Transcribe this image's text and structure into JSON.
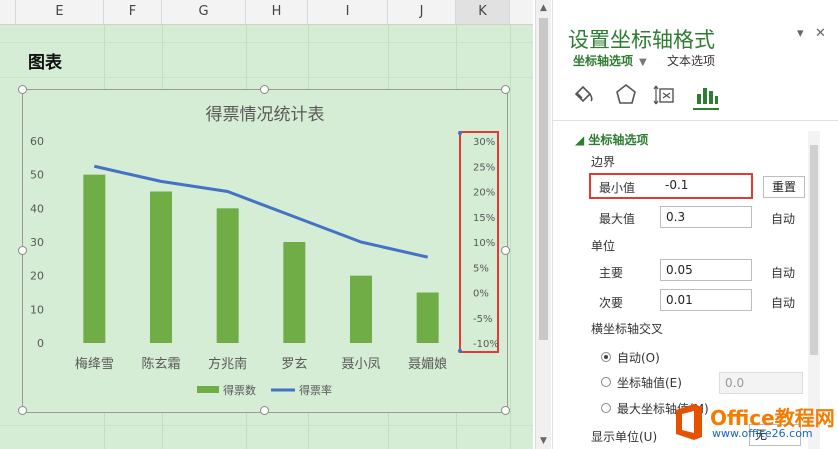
{
  "spreadsheet": {
    "columns": [
      "E",
      "F",
      "G",
      "H",
      "I",
      "J",
      "K"
    ],
    "selected_column": "K",
    "sheet_title": "图表"
  },
  "chart_data": {
    "type": "bar",
    "title": "得票情况统计表",
    "categories": [
      "梅绛雪",
      "陈玄霜",
      "方兆南",
      "罗玄",
      "聂小凤",
      "聂媚娘"
    ],
    "series": [
      {
        "name": "得票数",
        "type": "bar",
        "axis": "primary",
        "values": [
          50,
          45,
          40,
          30,
          20,
          15
        ],
        "color": "#70ad47"
      },
      {
        "name": "得票率",
        "type": "line",
        "axis": "secondary",
        "values": [
          0.25,
          0.22,
          0.2,
          0.15,
          0.1,
          0.07
        ],
        "color": "#4472c4"
      }
    ],
    "primary_axis": {
      "ylim": [
        0,
        60
      ],
      "ticks": [
        "0",
        "10",
        "20",
        "30",
        "40",
        "50",
        "60"
      ]
    },
    "secondary_axis": {
      "ylim": [
        -0.1,
        0.3
      ],
      "ticks": [
        "-10%",
        "-5%",
        "0%",
        "5%",
        "10%",
        "15%",
        "20%",
        "25%",
        "30%"
      ],
      "highlighted": true
    },
    "legend": "bottom",
    "grid": false
  },
  "pane": {
    "title": "设置坐标轴格式",
    "tab_axis_options": "坐标轴选项",
    "tab_text_options": "文本选项",
    "icons": [
      "fill-line-icon",
      "effects-icon",
      "size-properties-icon",
      "axis-options-icon"
    ],
    "section": "坐标轴选项",
    "bounds_label": "边界",
    "min_label": "最小值",
    "min_value": "-0.1",
    "reset_label": "重置",
    "max_label": "最大值",
    "max_value": "0.3",
    "max_auto": "自动",
    "units_label": "单位",
    "major_label": "主要",
    "major_value": "0.05",
    "major_auto": "自动",
    "minor_label": "次要",
    "minor_value": "0.01",
    "minor_auto": "自动",
    "cross_label": "横坐标轴交叉",
    "radio_auto": "自动(O)",
    "radio_axis_value": "坐标轴值(E)",
    "axis_value": "0.0",
    "radio_max": "最大坐标轴值(M)",
    "display_units_label": "显示单位(U)",
    "display_units_value": "无"
  },
  "watermark": {
    "text": "Office教程网",
    "url": "www.office26.com"
  }
}
